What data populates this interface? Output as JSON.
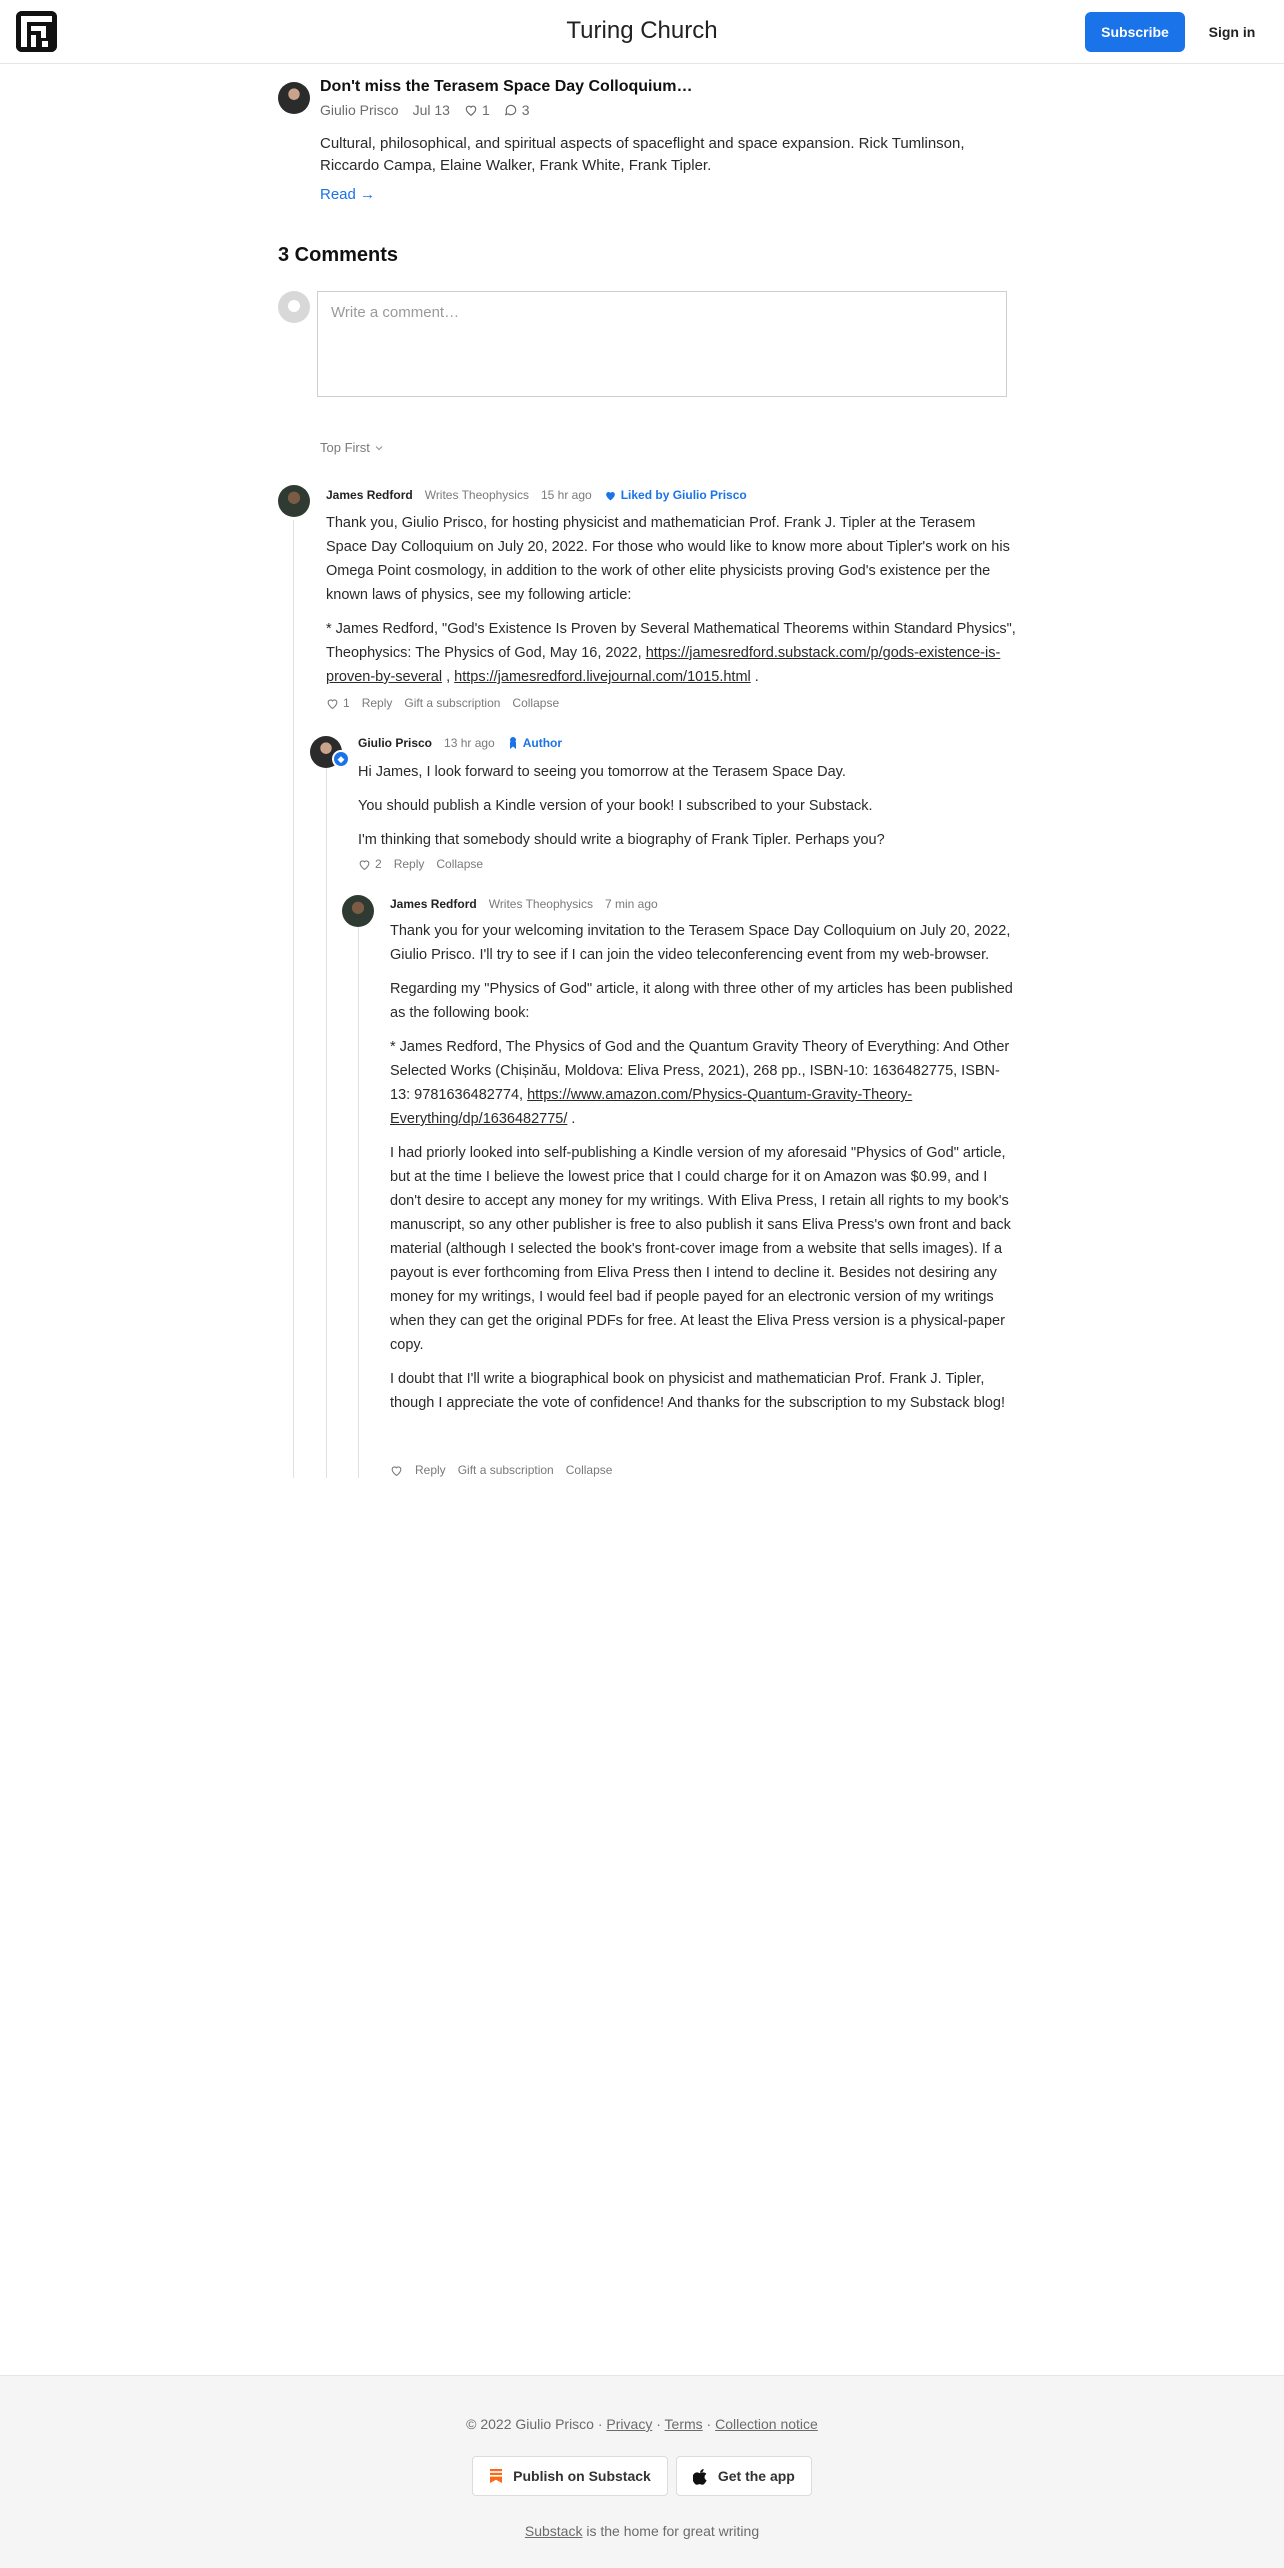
{
  "header": {
    "title": "Turing Church",
    "subscribe_label": "Subscribe",
    "signin_label": "Sign in"
  },
  "post": {
    "title": "Don't miss the Terasem Space Day Colloquium…",
    "author": "Giulio Prisco",
    "date": "Jul 13",
    "likes": "1",
    "comments": "3",
    "description": "Cultural, philosophical, and spiritual aspects of spaceflight and space expansion. Rick Tumlinson, Riccardo Campa, Elaine Walker, Frank White, Frank Tipler.",
    "read_label": "Read →"
  },
  "comments_section": {
    "heading": "3 Comments",
    "input_placeholder": "Write a comment…",
    "sort_label": "Top First"
  },
  "comments": [
    {
      "author": "James Redford",
      "note": "Writes Theophysics",
      "time": "15 hr ago",
      "liked_by": "Liked by Giulio Prisco",
      "p1": "Thank you, Giulio Prisco, for hosting physicist and mathematician Prof. Frank J. Tipler at the Terasem Space Day Colloquium on July 20, 2022. For those who would like to know more about Tipler's work on his Omega Point cosmology, in addition to the work of other elite physicists proving God's existence per the known laws of physics, see my following article:",
      "p2_text": "* James Redford, \"God's Existence Is Proven by Several Mathematical Theorems within Standard Physics\", Theophysics: The Physics of God, May 16, 2022,",
      "p2_link1": "https://jamesredford.substack.com/p/gods-existence-is-proven-by-several",
      "p2_sep": ",",
      "p2_link2": "https://jamesredford.livejournal.com/1015.html",
      "p2_end": ".",
      "likes": "1",
      "reply": "Reply",
      "gift": "Gift a subscription",
      "collapse": "Collapse"
    },
    {
      "author": "Giulio Prisco",
      "time": "13 hr ago",
      "badge": "Author",
      "p1": "Hi James, I look forward to seeing you tomorrow at the Terasem Space Day.",
      "p2": "You should publish a Kindle version of your book! I subscribed to your Substack.",
      "p3": "I'm thinking that somebody should write a biography of Frank Tipler. Perhaps you?",
      "likes": "2",
      "reply": "Reply",
      "collapse": "Collapse"
    },
    {
      "author": "James Redford",
      "note": "Writes Theophysics",
      "time": "7 min ago",
      "p1": "Thank you for your welcoming invitation to the Terasem Space Day Colloquium on July 20, 2022, Giulio Prisco. I'll try to see if I can join the video teleconferencing event from my web-browser.",
      "p2": "Regarding my \"Physics of God\" article, it along with three other of my articles has been published as the following book:",
      "p3_text": "* James Redford, The Physics of God and the Quantum Gravity Theory of Everything: And Other Selected Works (Chișinău, Moldova: Eliva Press, 2021), 268 pp., ISBN-10: 1636482775, ISBN-13: 9781636482774,",
      "p3_link": "https://www.amazon.com/Physics-Quantum-Gravity-Theory-Everything/dp/1636482775/",
      "p3_end": ".",
      "p4": "I had priorly looked into self-publishing a Kindle version of my aforesaid \"Physics of God\" article, but at the time I believe the lowest price that I could charge for it on Amazon was $0.99, and I don't desire to accept any money for my writings. With Eliva Press, I retain all rights to my book's manuscript, so any other publisher is free to also publish it sans Eliva Press's own front and back material (although I selected the book's front-cover image from a website that sells images). If a payout is ever forthcoming from Eliva Press then I intend to decline it. Besides not desiring any money for my writings, I would feel bad if people payed for an electronic version of my writings when they can get the original PDFs for free. At least the Eliva Press version is a physical-paper copy.",
      "p5": "I doubt that I'll write a biographical book on physicist and mathematician Prof. Frank J. Tipler, though I appreciate the vote of confidence! And thanks for the subscription to my Substack blog!",
      "reply": "Reply",
      "gift": "Gift a subscription",
      "collapse": "Collapse"
    }
  ],
  "footer": {
    "copyright": "© 2022 Giulio Prisco",
    "sep": "·",
    "privacy": "Privacy",
    "terms": "Terms",
    "collection": "Collection notice",
    "publish_label": "Publish on Substack",
    "app_label": "Get the app",
    "tag_link": "Substack",
    "tag_text": "is the home for great writing"
  },
  "colors": {
    "accent": "#1a73e8",
    "substack_orange": "#ff6719",
    "footer_bg": "#f5f5f5"
  }
}
